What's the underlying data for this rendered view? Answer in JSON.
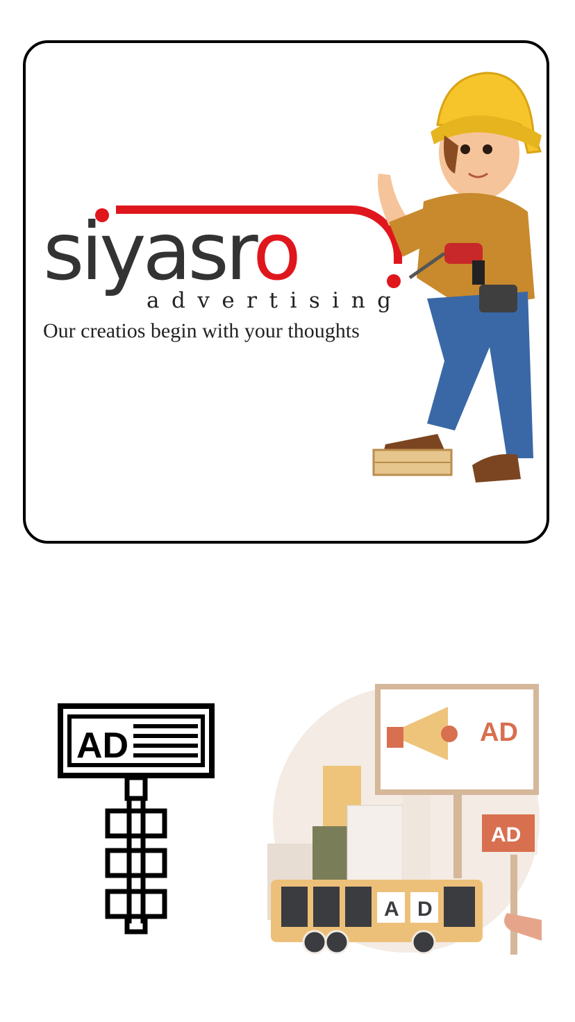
{
  "logo": {
    "brand_main": "siyasr",
    "brand_last": "o",
    "subtitle": "advertising",
    "tagline": "Our creatios begin with your thoughts"
  },
  "icons": {
    "worker": "construction-worker-illustration",
    "sign": "ad-signpost-icon",
    "city": "ad-city-bus-billboard-illustration"
  },
  "sign_icon": {
    "label": "AD"
  },
  "city_scene": {
    "billboard_label": "AD",
    "hand_sign_label": "AD",
    "bus_letter_1": "A",
    "bus_letter_2": "D"
  },
  "colors": {
    "brand_red": "#e0161d",
    "brand_grey": "#333333",
    "ad_orange": "#d86f4f",
    "bus_yellow": "#edc07a",
    "window_dark": "#3a3c40"
  }
}
